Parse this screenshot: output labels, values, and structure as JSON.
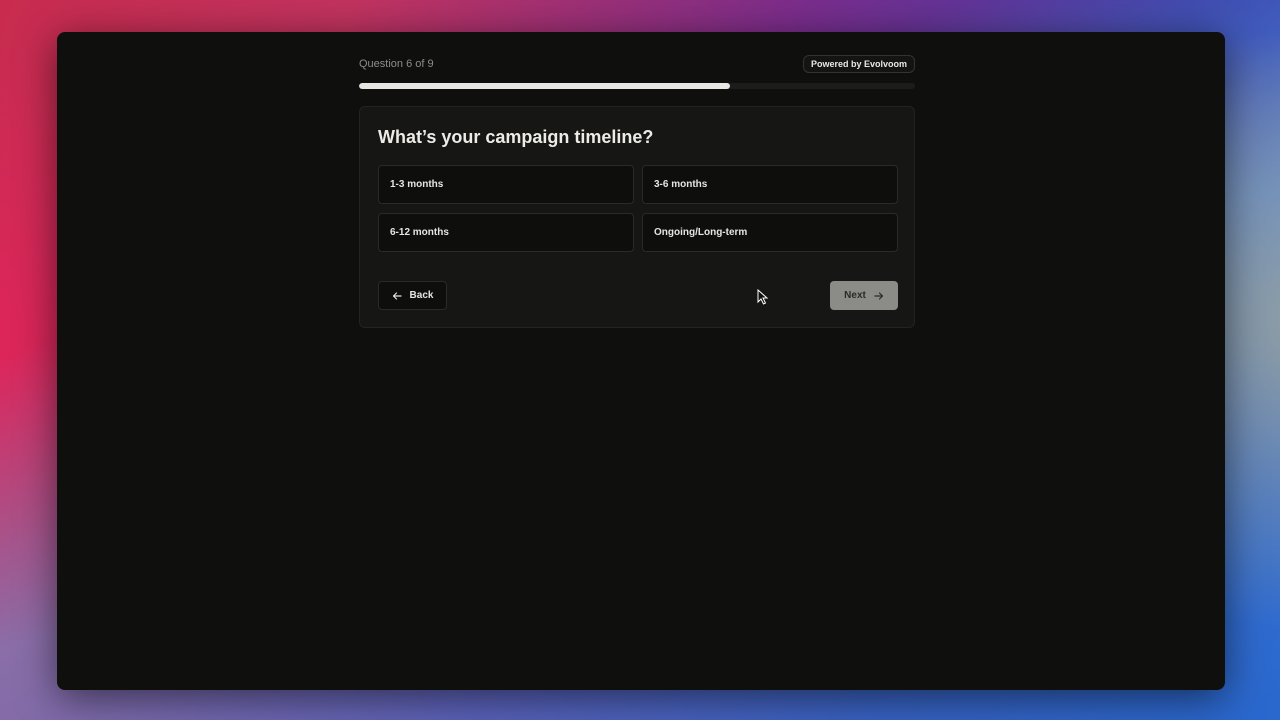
{
  "survey": {
    "counter": "Question 6 of 9",
    "powered_by": "Powered by Evolvoom",
    "progress": 0.667,
    "question": "What’s your campaign timeline?",
    "options": [
      {
        "label": "1-3 months"
      },
      {
        "label": "3-6 months"
      },
      {
        "label": "6-12 months"
      },
      {
        "label": "Ongoing/Long-term"
      }
    ],
    "back_label": "Back",
    "next_label": "Next"
  },
  "icons": {
    "back": "arrow-left-icon",
    "next": "arrow-right-icon",
    "cursor": "mouse-pointer-icon"
  },
  "colors": {
    "window_bg": "#0f0f0e",
    "progress_fill": "#e8e7e1",
    "next_button_bg": "#8b8b87"
  }
}
